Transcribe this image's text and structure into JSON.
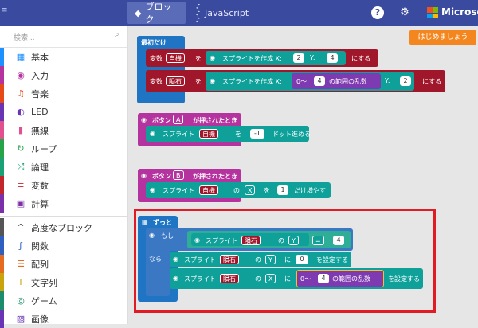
{
  "topbar": {
    "menu_glyph": "≡",
    "tabs": [
      {
        "label": "ブロック",
        "icon": "puzzle-icon",
        "active": true
      },
      {
        "label": "JavaScript",
        "icon": "braces-icon",
        "active": false
      }
    ],
    "help_icon": "?",
    "settings_icon": "⚙",
    "brand": "Microsoft"
  },
  "sidebar": {
    "search_placeholder": "検索...",
    "categories": [
      {
        "label": "基本",
        "color": "#1e90ff",
        "icon": "grid-icon",
        "glyph": "▦"
      },
      {
        "label": "入力",
        "color": "#b4339e",
        "icon": "target-icon",
        "glyph": "◉"
      },
      {
        "label": "音楽",
        "color": "#e64a19",
        "icon": "headphones-icon",
        "glyph": "♫"
      },
      {
        "label": "LED",
        "color": "#6a35b5",
        "icon": "toggle-icon",
        "glyph": "◐"
      },
      {
        "label": "無線",
        "color": "#e2518f",
        "icon": "signal-icon",
        "glyph": "▮"
      },
      {
        "label": "ループ",
        "color": "#27a34a",
        "icon": "refresh-icon",
        "glyph": "↻"
      },
      {
        "label": "論理",
        "color": "#1aa176",
        "icon": "shuffle-icon",
        "glyph": "⤮"
      },
      {
        "label": "変数",
        "color": "#c1272d",
        "icon": "list-icon",
        "glyph": "≡"
      },
      {
        "label": "計算",
        "color": "#7b2fa8",
        "icon": "calculator-icon",
        "glyph": "▣"
      },
      {
        "label": "高度なブロック",
        "color": "#555555",
        "icon": "chevron-up-icon",
        "glyph": "^"
      },
      {
        "label": "関数",
        "color": "#2f5fbf",
        "icon": "function-icon",
        "glyph": "ƒ"
      },
      {
        "label": "配列",
        "color": "#e66a1f",
        "icon": "array-icon",
        "glyph": "☰"
      },
      {
        "label": "文字列",
        "color": "#c9a40b",
        "icon": "text-icon",
        "glyph": "T"
      },
      {
        "label": "ゲーム",
        "color": "#1b8c6c",
        "icon": "gamepad-icon",
        "glyph": "◎"
      },
      {
        "label": "画像",
        "color": "#6a35b5",
        "icon": "image-icon",
        "glyph": "▧"
      }
    ]
  },
  "workspace": {
    "start_button": "はじめましょう",
    "on_start": {
      "hat": "最初だけ",
      "line1": {
        "var_prefix": "変数",
        "var": "自機",
        "to": "を",
        "create": "スプライトを作成 X:",
        "x": "2",
        "y_label": "Y:",
        "y": "4",
        "suffix": "にする"
      },
      "line2": {
        "var_prefix": "変数",
        "var": "隕石",
        "to": "を",
        "create": "スプライトを作成 X:",
        "range_prefix": "0〜",
        "range_value": "4",
        "range_suffix": "の範囲の乱数",
        "y_label": "Y:",
        "y": "2",
        "suffix": "にする"
      }
    },
    "button_a": {
      "hat_prefix": "ボタン",
      "button": "A",
      "hat_suffix": "が押されたとき",
      "sprite_label": "スプライト",
      "sprite_var": "自機",
      "particle": "を",
      "value": "-1",
      "action": "ドット進める"
    },
    "button_b": {
      "hat_prefix": "ボタン",
      "button": "B",
      "hat_suffix": "が押されたとき",
      "sprite_label": "スプライト",
      "sprite_var": "自機",
      "particle": "の",
      "axis": "X",
      "particle2": "を",
      "value": "1",
      "action": "だけ増やす"
    },
    "forever": {
      "hat": "ずっと",
      "if_label": "もし",
      "cond_sprite_label": "スプライト",
      "cond_var": "隕石",
      "cond_particle": "の",
      "cond_axis": "Y",
      "cond_op": "=",
      "cond_value": "4",
      "then_label": "なら",
      "set1": {
        "sprite_label": "スプライト",
        "var": "隕石",
        "particle": "の",
        "axis": "Y",
        "particle2": "に",
        "value": "0",
        "action": "を設定する"
      },
      "set2": {
        "sprite_label": "スプライト",
        "var": "隕石",
        "particle": "の",
        "axis": "X",
        "particle2": "に",
        "range_prefix": "0〜",
        "range_value": "4",
        "range_suffix": "の範囲の乱数",
        "action": "を設定する"
      }
    }
  },
  "colors": {
    "topbar": "#3a4a9e",
    "highlight": "#e01b24",
    "start_button": "#f4861f"
  }
}
